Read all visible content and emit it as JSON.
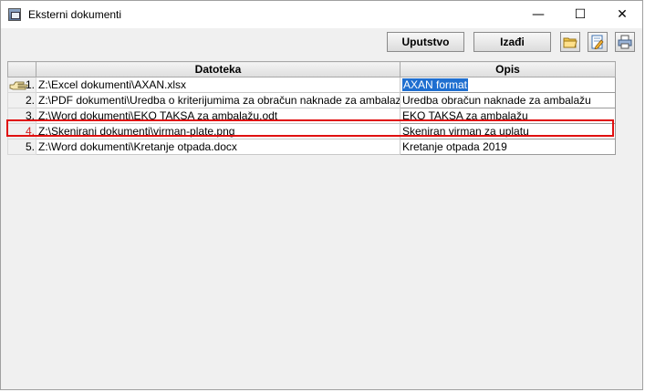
{
  "window": {
    "title": "Eksterni dokumenti",
    "controls": {
      "minimize": "—",
      "maximize": "☐",
      "close": "✕"
    }
  },
  "toolbar": {
    "help_label": "Uputstvo",
    "exit_label": "Izađi",
    "icons": [
      "folder-open-icon",
      "edit-document-icon",
      "print-icon"
    ]
  },
  "table": {
    "headers": {
      "file": "Datoteka",
      "description": "Opis"
    },
    "rows": [
      {
        "num": "1.",
        "file": "Z:\\Excel dokumenti\\AXAN.xlsx",
        "description": "AXAN format"
      },
      {
        "num": "2.",
        "file": "Z:\\PDF dokumenti\\Uredba o kriterijumima za obračun naknade za ambalazu.pdf",
        "description": "Uredba obračun naknade za ambalažu"
      },
      {
        "num": "3.",
        "file": "Z:\\Word dokumenti\\EKO TAKSA za ambalažu.odt",
        "description": "EKO TAKSA za ambalažu"
      },
      {
        "num": "4.",
        "file": "Z:\\Skenirani dokumenti\\virman-plate.png",
        "description": "Skeniran virman za uplatu"
      },
      {
        "num": "5.",
        "file": "Z:\\Word dokumenti\\Kretanje otpada.docx",
        "description": "Kretanje otpada 2019"
      }
    ],
    "selected_row": 4
  },
  "colors": {
    "selection_frame": "#e01010",
    "text_highlight": "#1f6fd0"
  }
}
